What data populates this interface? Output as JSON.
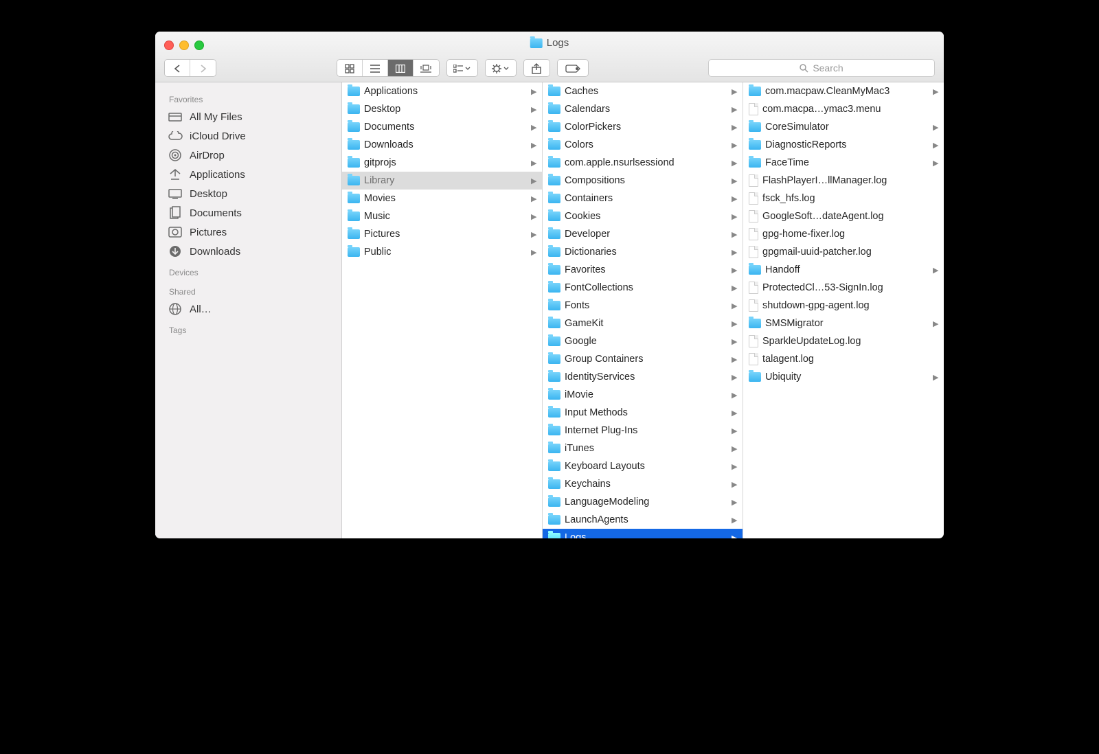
{
  "window": {
    "title": "Logs"
  },
  "toolbar": {
    "search_placeholder": "Search",
    "view_mode": "column"
  },
  "sidebar": {
    "sections": [
      {
        "title": "Favorites",
        "items": [
          {
            "label": "All My Files",
            "icon": "all-my-files"
          },
          {
            "label": "iCloud Drive",
            "icon": "cloud"
          },
          {
            "label": "AirDrop",
            "icon": "airdrop"
          },
          {
            "label": "Applications",
            "icon": "applications"
          },
          {
            "label": "Desktop",
            "icon": "desktop"
          },
          {
            "label": "Documents",
            "icon": "documents"
          },
          {
            "label": "Pictures",
            "icon": "pictures"
          },
          {
            "label": "Downloads",
            "icon": "downloads"
          }
        ]
      },
      {
        "title": "Devices",
        "items": []
      },
      {
        "title": "Shared",
        "items": [
          {
            "label": "All…",
            "icon": "network"
          }
        ]
      },
      {
        "title": "Tags",
        "items": []
      }
    ]
  },
  "columns": [
    {
      "items": [
        {
          "label": "Applications",
          "type": "folder",
          "has_children": true
        },
        {
          "label": "Desktop",
          "type": "folder",
          "has_children": true
        },
        {
          "label": "Documents",
          "type": "folder",
          "has_children": true
        },
        {
          "label": "Downloads",
          "type": "folder",
          "has_children": true
        },
        {
          "label": "gitprojs",
          "type": "folder",
          "has_children": true
        },
        {
          "label": "Library",
          "type": "folder",
          "has_children": true,
          "selection": "parent"
        },
        {
          "label": "Movies",
          "type": "folder",
          "has_children": true
        },
        {
          "label": "Music",
          "type": "folder",
          "has_children": true
        },
        {
          "label": "Pictures",
          "type": "folder",
          "has_children": true
        },
        {
          "label": "Public",
          "type": "folder",
          "has_children": true
        }
      ]
    },
    {
      "items": [
        {
          "label": "Caches",
          "type": "folder",
          "has_children": true
        },
        {
          "label": "Calendars",
          "type": "folder",
          "has_children": true
        },
        {
          "label": "ColorPickers",
          "type": "folder",
          "has_children": true
        },
        {
          "label": "Colors",
          "type": "folder",
          "has_children": true
        },
        {
          "label": "com.apple.nsurlsessiond",
          "type": "folder",
          "has_children": true
        },
        {
          "label": "Compositions",
          "type": "folder",
          "has_children": true
        },
        {
          "label": "Containers",
          "type": "folder",
          "has_children": true
        },
        {
          "label": "Cookies",
          "type": "folder",
          "has_children": true
        },
        {
          "label": "Developer",
          "type": "folder",
          "has_children": true
        },
        {
          "label": "Dictionaries",
          "type": "folder",
          "has_children": true
        },
        {
          "label": "Favorites",
          "type": "folder",
          "has_children": true
        },
        {
          "label": "FontCollections",
          "type": "folder",
          "has_children": true
        },
        {
          "label": "Fonts",
          "type": "folder",
          "has_children": true
        },
        {
          "label": "GameKit",
          "type": "folder",
          "has_children": true
        },
        {
          "label": "Google",
          "type": "folder",
          "has_children": true
        },
        {
          "label": "Group Containers",
          "type": "folder",
          "has_children": true
        },
        {
          "label": "IdentityServices",
          "type": "folder",
          "has_children": true
        },
        {
          "label": "iMovie",
          "type": "folder",
          "has_children": true
        },
        {
          "label": "Input Methods",
          "type": "folder",
          "has_children": true
        },
        {
          "label": "Internet Plug-Ins",
          "type": "folder",
          "has_children": true
        },
        {
          "label": "iTunes",
          "type": "folder",
          "has_children": true
        },
        {
          "label": "Keyboard Layouts",
          "type": "folder",
          "has_children": true
        },
        {
          "label": "Keychains",
          "type": "folder",
          "has_children": true
        },
        {
          "label": "LanguageModeling",
          "type": "folder",
          "has_children": true
        },
        {
          "label": "LaunchAgents",
          "type": "folder",
          "has_children": true
        },
        {
          "label": "Logs",
          "type": "folder",
          "has_children": true,
          "selection": "active"
        }
      ]
    },
    {
      "items": [
        {
          "label": "com.macpaw.CleanMyMac3",
          "type": "folder",
          "has_children": true
        },
        {
          "label": "com.macpa…ymac3.menu",
          "type": "file"
        },
        {
          "label": "CoreSimulator",
          "type": "folder",
          "has_children": true
        },
        {
          "label": "DiagnosticReports",
          "type": "folder",
          "has_children": true
        },
        {
          "label": "FaceTime",
          "type": "folder",
          "has_children": true
        },
        {
          "label": "FlashPlayerI…llManager.log",
          "type": "file"
        },
        {
          "label": "fsck_hfs.log",
          "type": "file"
        },
        {
          "label": "GoogleSoft…dateAgent.log",
          "type": "file"
        },
        {
          "label": "gpg-home-fixer.log",
          "type": "file"
        },
        {
          "label": "gpgmail-uuid-patcher.log",
          "type": "file"
        },
        {
          "label": "Handoff",
          "type": "folder",
          "has_children": true
        },
        {
          "label": "ProtectedCl…53-SignIn.log",
          "type": "file"
        },
        {
          "label": "shutdown-gpg-agent.log",
          "type": "file"
        },
        {
          "label": "SMSMigrator",
          "type": "folder",
          "has_children": true
        },
        {
          "label": "SparkleUpdateLog.log",
          "type": "file"
        },
        {
          "label": "talagent.log",
          "type": "file"
        },
        {
          "label": "Ubiquity",
          "type": "folder",
          "has_children": true
        }
      ]
    }
  ]
}
